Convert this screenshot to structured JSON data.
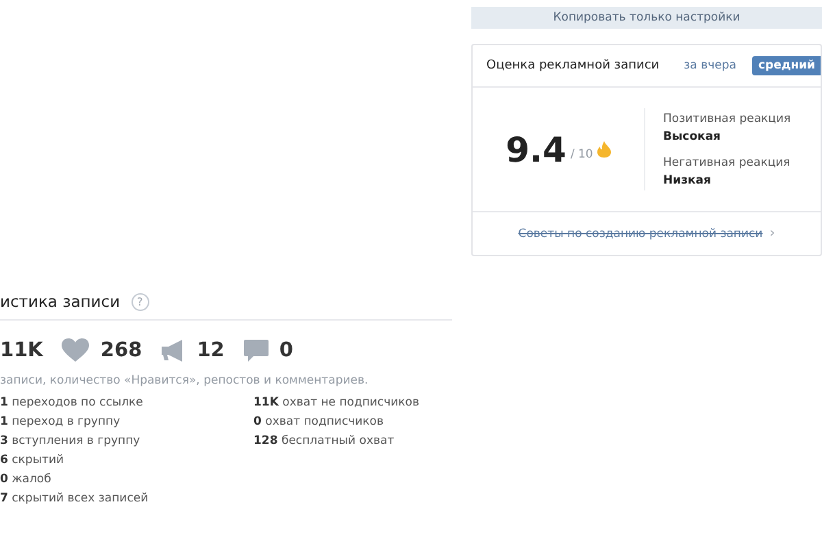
{
  "copy_button": "Копировать только настройки",
  "rating_card": {
    "title": "Оценка рекламной записи",
    "periods": [
      {
        "label": "за вчера",
        "selected": false
      },
      {
        "label": "средний",
        "selected": true
      }
    ],
    "score": "9.4",
    "score_max": "/ 10",
    "reactions": [
      {
        "label": "Позитивная реакция",
        "value": "Высокая"
      },
      {
        "label": "Негативная реакция",
        "value": "Низкая"
      }
    ],
    "tips_link": "Советы по созданию рекламной записи",
    "tips_arrow": "›"
  },
  "stats": {
    "title": "истика записи",
    "help": "?",
    "counters": [
      {
        "kind": "views",
        "value": "11K"
      },
      {
        "kind": "likes",
        "value": "268"
      },
      {
        "kind": "reposts",
        "value": "12"
      },
      {
        "kind": "comments",
        "value": "0"
      }
    ],
    "description": "записи, количество «Нравится», репостов и комментариев.",
    "left_rows": [
      "**1** переходов по ссылке",
      "**1** переход в группу",
      "**3** вступления в группу",
      "**6** скрытий",
      "**0** жалоб",
      "**7** скрытий всех записей"
    ],
    "right_rows": [
      "**11K** охват не подписчиков",
      "**0** охват подписчиков",
      "**128** бесплатный охват"
    ]
  }
}
